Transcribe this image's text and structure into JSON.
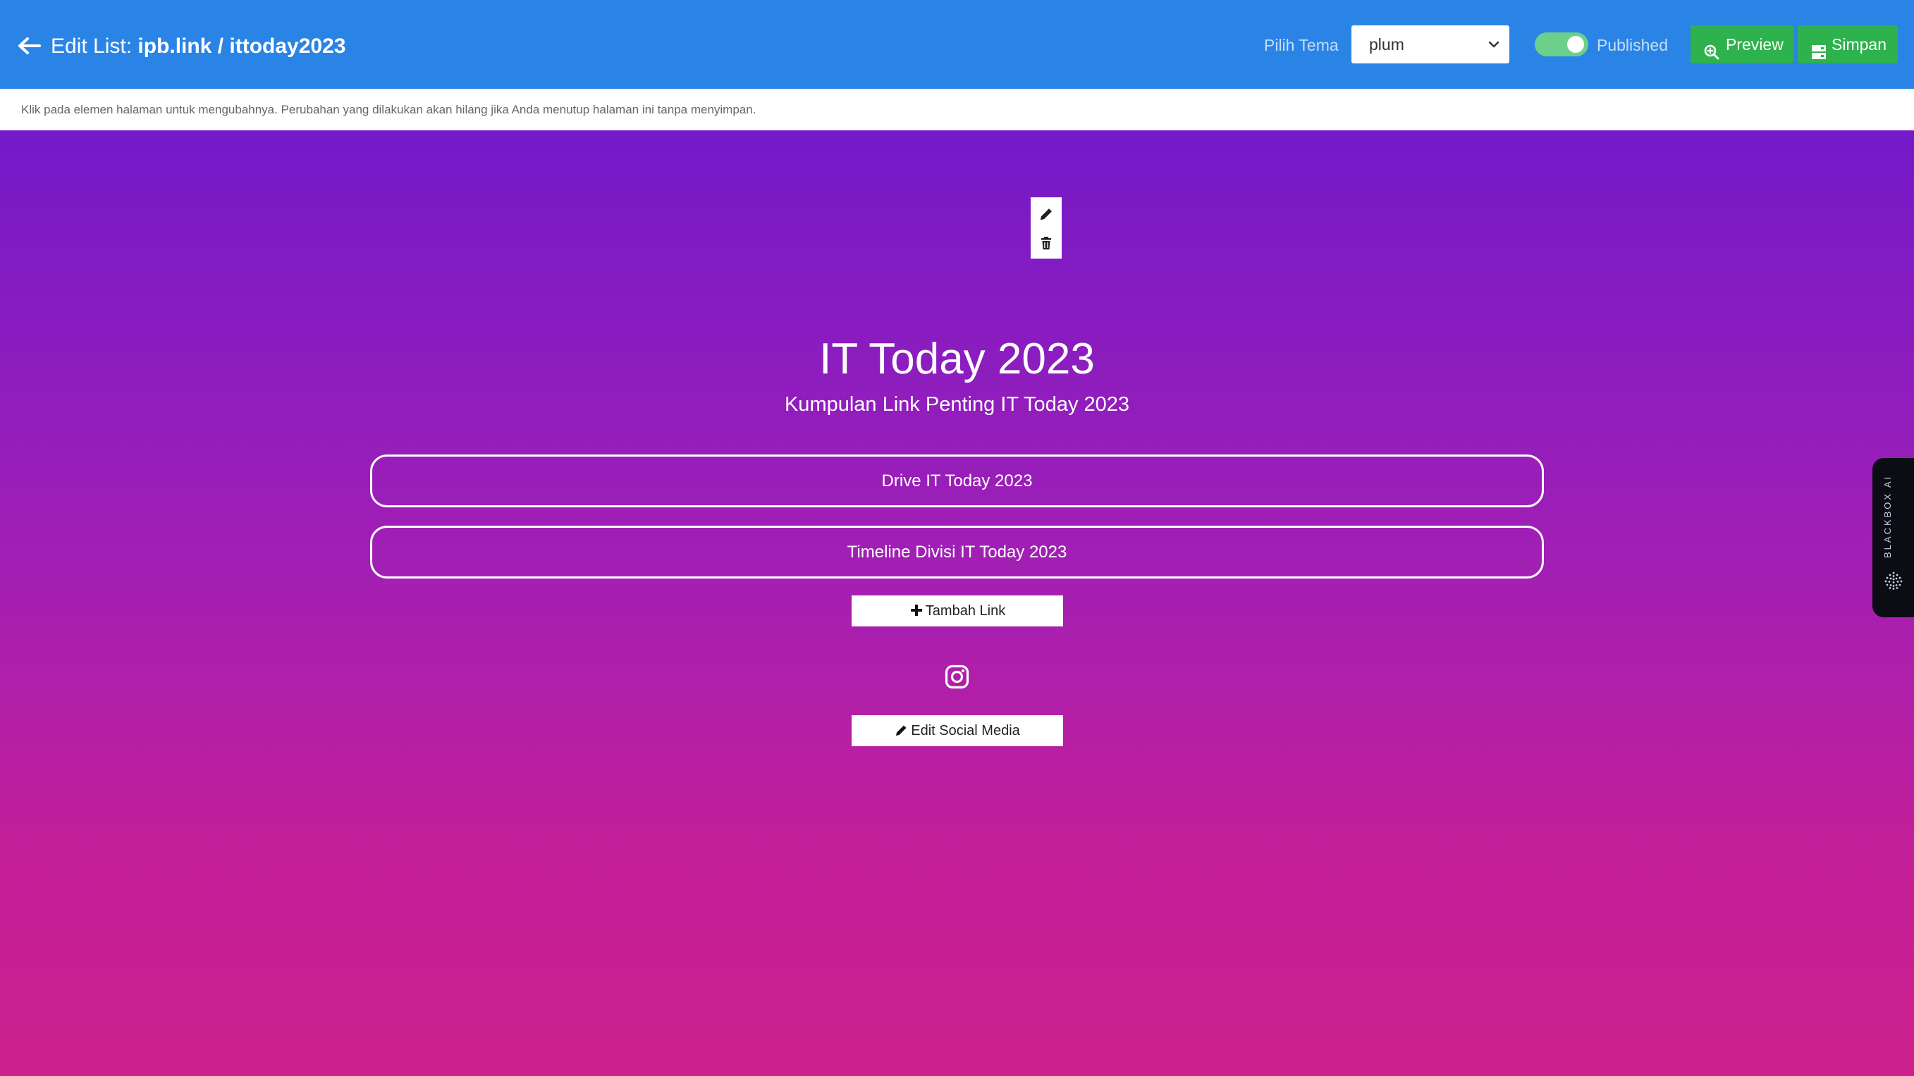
{
  "header": {
    "title_prefix": "Edit List:",
    "title_path": "ipb.link / ittoday2023",
    "theme_label": "Pilih Tema",
    "theme_value": "plum",
    "published_label": "Published",
    "published_on": true,
    "preview_label": "Preview",
    "save_label": "Simpan"
  },
  "info": {
    "message": "Klik pada elemen halaman untuk mengubahnya. Perubahan yang dilakukan akan hilang jika Anda menutup halaman ini tanpa menyimpan."
  },
  "page": {
    "title": "IT Today 2023",
    "subtitle": "Kumpulan Link Penting IT Today 2023",
    "links": [
      {
        "label": "Drive IT Today 2023"
      },
      {
        "label": "Timeline Divisi IT Today 2023"
      }
    ],
    "add_link_label": "Tambah Link",
    "social_icons": [
      "instagram-icon"
    ],
    "edit_social_label": "Edit Social Media"
  },
  "side_tab": {
    "label": "BLACKBOX AI"
  },
  "colors": {
    "header_bg": "#2a84e6",
    "action_green": "#2eb24d",
    "gradient_top": "#741ac9",
    "gradient_bottom": "#cc1f8c"
  }
}
